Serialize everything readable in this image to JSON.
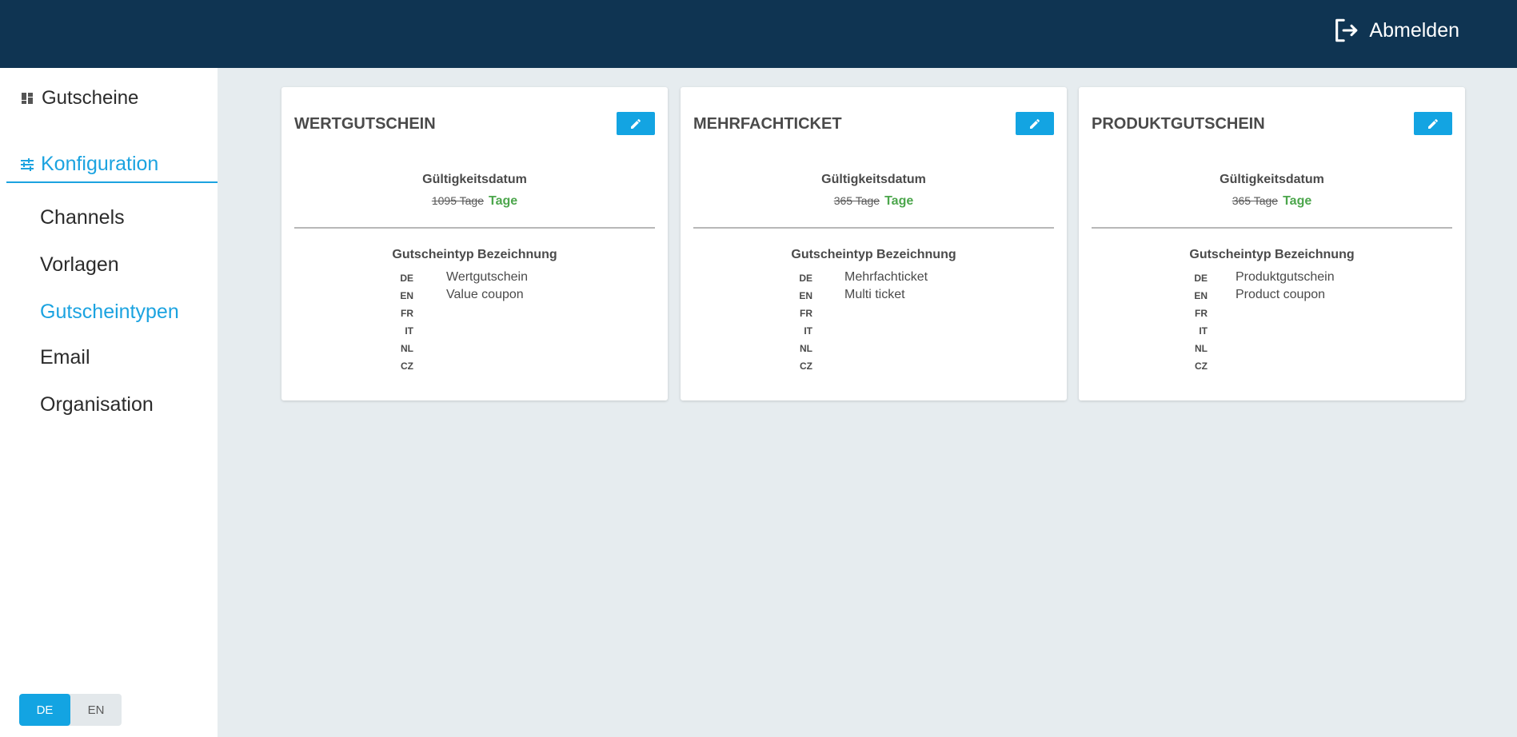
{
  "header": {
    "logout_label": "Abmelden"
  },
  "sidebar": {
    "top_item": "Gutscheine",
    "section": "Konfiguration",
    "items": [
      {
        "label": "Channels",
        "active": false
      },
      {
        "label": "Vorlagen",
        "active": false
      },
      {
        "label": "Gutscheintypen",
        "active": true
      },
      {
        "label": "Email",
        "active": false
      },
      {
        "label": "Organisation",
        "active": false
      }
    ],
    "languages": [
      {
        "label": "DE",
        "active": true
      },
      {
        "label": "EN",
        "active": false
      }
    ]
  },
  "cards": [
    {
      "title": "WERTGUTSCHEIN",
      "validity_label": "Gültigkeitsdatum",
      "validity_old": "1095 Tage",
      "validity_unit": "Tage",
      "names_label": "Gutscheintyp Bezeichnung",
      "names": [
        {
          "lang": "DE",
          "value": "Wertgutschein"
        },
        {
          "lang": "EN",
          "value": "Value coupon"
        },
        {
          "lang": "FR",
          "value": ""
        },
        {
          "lang": "IT",
          "value": ""
        },
        {
          "lang": "NL",
          "value": ""
        },
        {
          "lang": "CZ",
          "value": ""
        }
      ]
    },
    {
      "title": "MEHRFACHTICKET",
      "validity_label": "Gültigkeitsdatum",
      "validity_old": "365 Tage",
      "validity_unit": "Tage",
      "names_label": "Gutscheintyp Bezeichnung",
      "names": [
        {
          "lang": "DE",
          "value": "Mehrfachticket"
        },
        {
          "lang": "EN",
          "value": "Multi ticket"
        },
        {
          "lang": "FR",
          "value": ""
        },
        {
          "lang": "IT",
          "value": ""
        },
        {
          "lang": "NL",
          "value": ""
        },
        {
          "lang": "CZ",
          "value": ""
        }
      ]
    },
    {
      "title": "PRODUKTGUTSCHEIN",
      "validity_label": "Gültigkeitsdatum",
      "validity_old": "365 Tage",
      "validity_unit": "Tage",
      "names_label": "Gutscheintyp Bezeichnung",
      "names": [
        {
          "lang": "DE",
          "value": "Produktgutschein"
        },
        {
          "lang": "EN",
          "value": "Product coupon"
        },
        {
          "lang": "FR",
          "value": ""
        },
        {
          "lang": "IT",
          "value": ""
        },
        {
          "lang": "NL",
          "value": ""
        },
        {
          "lang": "CZ",
          "value": ""
        }
      ]
    }
  ],
  "colors": {
    "header_bg": "#0f3452",
    "accent": "#13a4e2",
    "validity_green": "#4ca64c",
    "page_bg": "#e6ecef"
  },
  "icons": {
    "logout": "logout-icon",
    "dashboard": "dashboard-icon",
    "config": "sliders-icon",
    "edit": "pencil-icon"
  }
}
